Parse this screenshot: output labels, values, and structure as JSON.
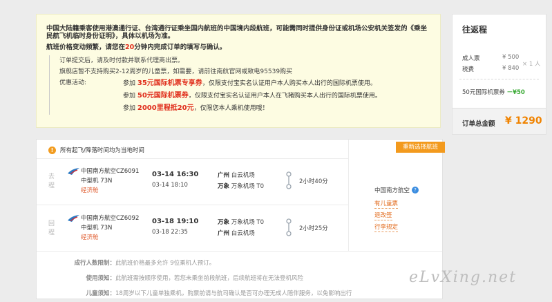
{
  "notice": {
    "head": "中国大陆籍乘客使用港澳通行证、台湾通行证乘坐国内航班的中国境内段航班，可能需同时提供身份证或机场公安机关签发的《乘坐民航飞机临时身份证明》，具体以机场为准。",
    "line2_prefix": "航班价格变动频繁，请您在",
    "line2_minutes": "20",
    "line2_suffix": "分钟内完成订单的填写与确认。",
    "bullets": [
      "订单提交后，请及时付款并联系代理商出票。",
      "旗舰店暂不支持购买2-12周岁的儿童票，如需要，请前往南航官网或致电95539购买"
    ],
    "promo_label": "优惠活动:",
    "promos": [
      {
        "prefix": "参加",
        "highlight": "35元国际机票专享券",
        "suffix": "，仅限支付宝实名认证用户本人购买本人出行的国际机票使用。"
      },
      {
        "prefix": "参加",
        "highlight": "50元国际机票券",
        "suffix": "，仅限支付宝实名认证用户本人在飞猪购买本人出行的国际机票使用。"
      },
      {
        "prefix": "参加",
        "highlight": "2000里程抵20元",
        "suffix": "，仅限您本人乘机使用哦！"
      }
    ]
  },
  "price": {
    "title": "往返程",
    "adult_label": "成人票",
    "adult_value": "¥ 500",
    "tax_label": "税费",
    "tax_value": "¥ 840",
    "times": "× 1 人",
    "intl_label": "50元国际机票券",
    "intl_value": "－¥50",
    "total_label": "订单总金额",
    "total_value": "¥ 1290"
  },
  "flight": {
    "warning": "所有起飞/降落时间均为当地时间",
    "rebook": "重新选择航班",
    "segments": [
      {
        "dir": "去程",
        "airline": "中国南方航空CZ6091",
        "plane": "中型机 73N",
        "cabin": "经济舱",
        "dep_time": "03-14 16:30",
        "arr_time": "03-14 18:10",
        "dep_city": "广州",
        "dep_airport": "白云机场",
        "arr_city": "万象",
        "arr_airport": "万象机场 T0",
        "duration": "2小时40分"
      },
      {
        "dir": "回程",
        "airline": "中国南方航空CZ6092",
        "plane": "中型机 73N",
        "cabin": "经济舱",
        "dep_time": "03-18 19:10",
        "arr_time": "03-18 22:35",
        "dep_city": "万象",
        "dep_airport": "万象机场 T0",
        "arr_city": "广州",
        "arr_airport": "白云机场",
        "duration": "2小时25分"
      }
    ],
    "carrier": "中国南方航空",
    "links": [
      "有儿童票",
      "退改签",
      "行李规定"
    ],
    "notes": [
      {
        "label": "成行人数限制：",
        "text": "此航班价格最多允许 9位乘机人预订。"
      },
      {
        "label": "使用须知：",
        "text": "此航班需按顺序使用，若您未乘坐前段航班，后续航班将在无法登机风险"
      },
      {
        "label": "儿童须知：",
        "text": "18周岁以下儿童单独乘机，购票前请与航司确认是否可办理无成人陪伴服务，以免影响出行"
      }
    ]
  },
  "watermark": "eLvXing.net",
  "colors": {
    "accent": "#f08300",
    "red": "#e02e1c",
    "green": "#3aaa35",
    "notice_bg": "#fdfce2"
  }
}
